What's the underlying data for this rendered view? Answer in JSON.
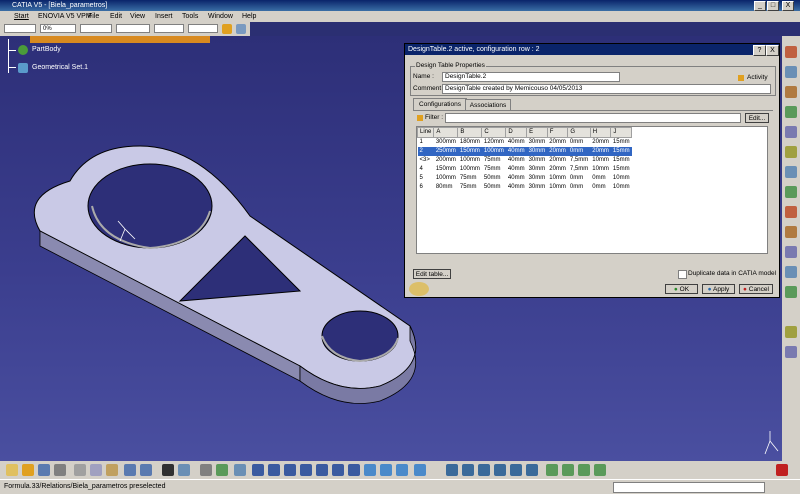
{
  "window": {
    "title": "CATIA V5 - [Biela_parametros]",
    "minimize": "_",
    "maximize": "□",
    "close": "X"
  },
  "menu": [
    "Start",
    "ENOVIA V5 VPM",
    "File",
    "Edit",
    "View",
    "Insert",
    "Tools",
    "Window",
    "Help"
  ],
  "toolbar": {
    "color_value": "",
    "transparency_value": "0%",
    "line_type_value": "",
    "line_weight_value": ""
  },
  "tree": {
    "part_body": "PartBody",
    "geometrical_set": "Geometrical Set.1"
  },
  "status": {
    "text": "Formula.33/Relations/Biela_parametros preselected"
  },
  "dialog": {
    "title": "DesignTable.2 active, configuration row : 2",
    "help_btn": "?",
    "close_btn": "X",
    "group_label": "Design Table Properties",
    "name_label": "Name :",
    "name_value": "DesignTable.2",
    "activity_label": "Activity",
    "comment_label": "Comment :",
    "comment_value": "DesignTable created by Memicouso 04/05/2013",
    "tabs": [
      "Configurations",
      "Associations"
    ],
    "filter_label": "Filter :",
    "filter_value": "",
    "edit_filter_btn": "Edit...",
    "edit_table_btn": "Edit table...",
    "duplicate_label": "Duplicate data in CATIA model",
    "ok": "OK",
    "apply": "Apply",
    "cancel": "Cancel",
    "table": {
      "headers": [
        "Line",
        "A",
        "B",
        "C",
        "D",
        "E",
        "F",
        "G",
        "H",
        "J"
      ],
      "rows": [
        [
          "1",
          "300mm",
          "180mm",
          "120mm",
          "40mm",
          "30mm",
          "20mm",
          "0mm",
          "20mm",
          "15mm"
        ],
        [
          "2",
          "250mm",
          "150mm",
          "100mm",
          "40mm",
          "30mm",
          "20mm",
          "0mm",
          "20mm",
          "15mm"
        ],
        [
          "<3>",
          "200mm",
          "100mm",
          "75mm",
          "40mm",
          "30mm",
          "20mm",
          "7,5mm",
          "10mm",
          "15mm"
        ],
        [
          "4",
          "150mm",
          "100mm",
          "75mm",
          "40mm",
          "30mm",
          "20mm",
          "7,5mm",
          "10mm",
          "15mm"
        ],
        [
          "5",
          "100mm",
          "75mm",
          "50mm",
          "40mm",
          "30mm",
          "10mm",
          "0mm",
          "0mm",
          "10mm"
        ],
        [
          "6",
          "80mm",
          "75mm",
          "50mm",
          "40mm",
          "30mm",
          "10mm",
          "0mm",
          "0mm",
          "10mm"
        ]
      ],
      "selected_row": 1
    }
  },
  "colors": {
    "viewport": "#2d2f78",
    "selection": "#3166c3",
    "title": "#0a246a"
  }
}
